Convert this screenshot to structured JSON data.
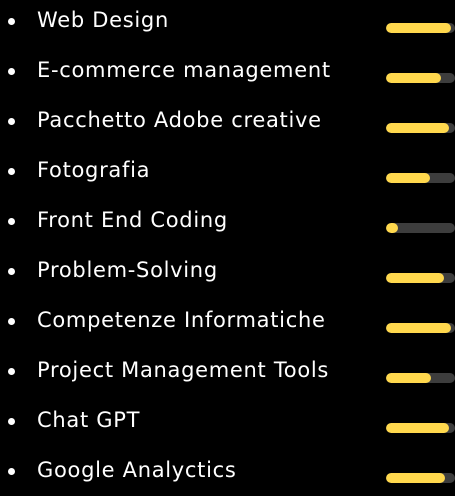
{
  "colors": {
    "background": "#000000",
    "text": "#ffffff",
    "bar_fill": "#ffd84d",
    "bar_track": "#3d3d3d"
  },
  "skills": [
    {
      "label": "Web Design",
      "level": 0.94
    },
    {
      "label": "E-commerce management",
      "level": 0.79
    },
    {
      "label": "Pacchetto Adobe creative",
      "level": 0.92
    },
    {
      "label": "Fotografia",
      "level": 0.64
    },
    {
      "label": "Front End Coding",
      "level": 0.17
    },
    {
      "label": "Problem-Solving",
      "level": 0.84
    },
    {
      "label": "Competenze Informatiche",
      "level": 0.94
    },
    {
      "label": "Project Management Tools",
      "level": 0.65
    },
    {
      "label": "Chat GPT",
      "level": 0.92
    },
    {
      "label": "Google Analyctics",
      "level": 0.86
    }
  ]
}
